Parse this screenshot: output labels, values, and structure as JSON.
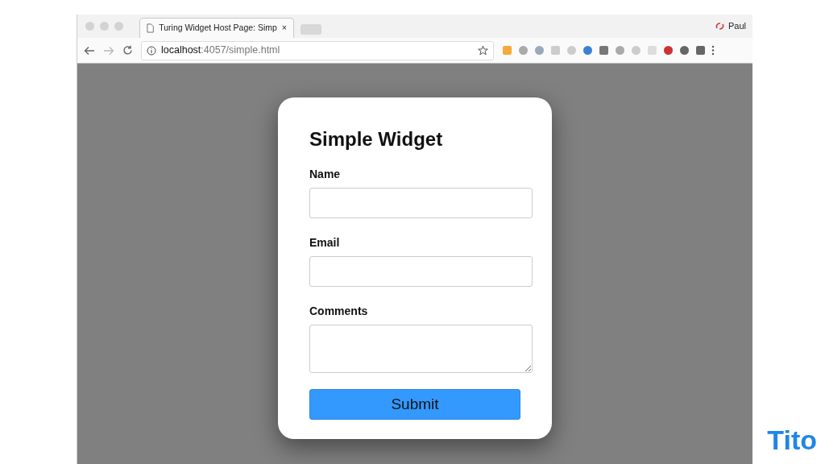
{
  "browser": {
    "tab": {
      "title": "Turing Widget Host Page: Simp",
      "close": "×",
      "selected": true
    },
    "profile": "Paul",
    "address": "**localhost**:4057/simple.html"
  },
  "form": {
    "title": "Simple Widget",
    "fields": [
      {
        "label": "Name",
        "kind": "input"
      },
      {
        "label": "Email",
        "kind": "input"
      },
      {
        "label": "Comments",
        "kind": "textarea"
      }
    ],
    "submit": "Submit"
  },
  "logo": "Tito"
}
